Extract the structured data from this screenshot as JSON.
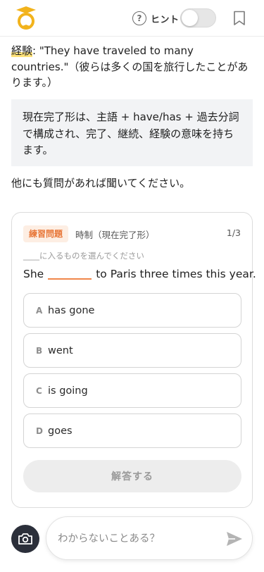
{
  "header": {
    "hint_icon": "question-circle-icon",
    "hint_label": "ヒント",
    "hint_enabled": false,
    "bookmark_icon": "bookmark-icon",
    "logo_icon": "graduation-mascot-logo"
  },
  "chat": {
    "example_word": "経験",
    "example_rest": ": \"They have traveled to many countries.\"（彼らは多くの国を旅行したことがあります。）",
    "note": "現在完了形は、主語 + have/has + 過去分詞で構成され、完了、継続、経験の意味を持ちます。",
    "closing": "他にも質問があれば聞いてください。"
  },
  "quiz": {
    "tag": "練習問題",
    "topic": "時制（現在完了形）",
    "counter": "1/3",
    "instruction": "____に入るものを選んでください",
    "sentence_before": "She",
    "sentence_after": "to Paris three times this year.",
    "options": [
      {
        "letter": "A",
        "text": "has gone"
      },
      {
        "letter": "B",
        "text": "went"
      },
      {
        "letter": "C",
        "text": "is going"
      },
      {
        "letter": "D",
        "text": "goes"
      }
    ],
    "submit_label": "解答する"
  },
  "composer": {
    "camera_icon": "camera-icon",
    "placeholder": "わからないことある？",
    "send_icon": "send-icon"
  },
  "colors": {
    "accent_orange": "#f0874a",
    "tag_bg": "#fdeee3",
    "highlight": "#ffe27a",
    "logo_gold": "#f2b31c"
  }
}
